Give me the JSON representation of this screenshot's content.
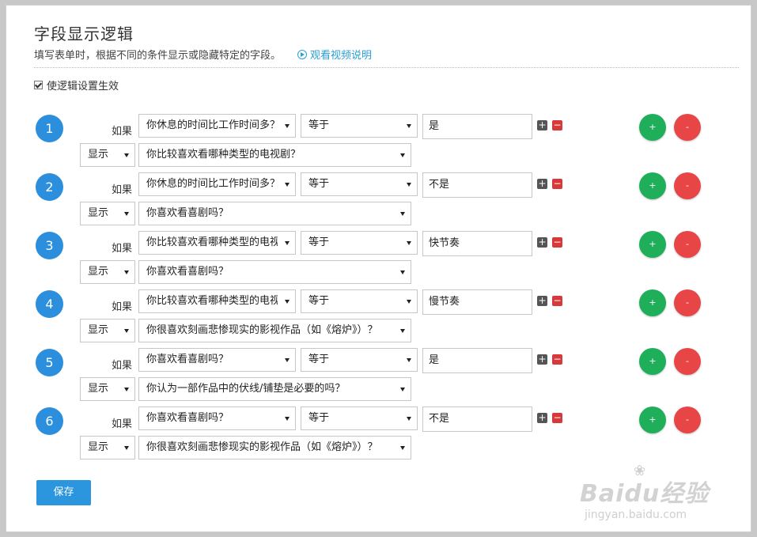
{
  "header": {
    "title": "字段显示逻辑",
    "description": "填写表单时，根据不同的条件显示或隐藏特定的字段。",
    "video_link": "观看视频说明"
  },
  "enable_checkbox": {
    "label": "使逻辑设置生效",
    "checked": true
  },
  "labels": {
    "if": "如果",
    "add_small": "+",
    "remove_small": "−",
    "add": "+",
    "remove": "-"
  },
  "rules": [
    {
      "number": "1",
      "field": "你休息的时间比工作时间多？",
      "operator": "等于",
      "value": "是",
      "action": "显示",
      "target": "你比较喜欢看哪种类型的电视剧？"
    },
    {
      "number": "2",
      "field": "你休息的时间比工作时间多？",
      "operator": "等于",
      "value": "不是",
      "action": "显示",
      "target": "你喜欢看喜剧吗？"
    },
    {
      "number": "3",
      "field": "你比较喜欢看哪种类型的电视剧？",
      "operator": "等于",
      "value": "快节奏",
      "action": "显示",
      "target": "你喜欢看喜剧吗？"
    },
    {
      "number": "4",
      "field": "你比较喜欢看哪种类型的电视剧？",
      "operator": "等于",
      "value": "慢节奏",
      "action": "显示",
      "target": "你很喜欢刻画悲惨现实的影视作品（如《熔炉》）？"
    },
    {
      "number": "5",
      "field": "你喜欢看喜剧吗？",
      "operator": "等于",
      "value": "是",
      "action": "显示",
      "target": "你认为一部作品中的伏线/铺垫是必要的吗？"
    },
    {
      "number": "6",
      "field": "你喜欢看喜剧吗？",
      "operator": "等于",
      "value": "不是",
      "action": "显示",
      "target": "你很喜欢刻画悲惨现实的影视作品（如《熔炉》）？"
    }
  ],
  "save_button": "保存",
  "watermark": {
    "logo": "Baidu经验",
    "sub": "jingyan.baidu.com"
  },
  "colors": {
    "accent": "#2b8fdd",
    "add_green": "#1fae5a",
    "remove_red": "#e84646",
    "link": "#2a9fd6"
  }
}
